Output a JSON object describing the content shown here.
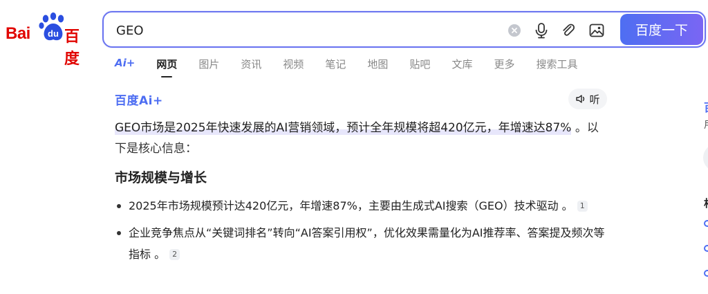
{
  "logo": {
    "latin": "Bai",
    "paw_text": "du",
    "chinese": "百度"
  },
  "search": {
    "value": "GEO",
    "button_label": "百度一下"
  },
  "tabs": [
    {
      "label": "Ai+"
    },
    {
      "label": "网页"
    },
    {
      "label": "图片"
    },
    {
      "label": "资讯"
    },
    {
      "label": "视频"
    },
    {
      "label": "笔记"
    },
    {
      "label": "地图"
    },
    {
      "label": "贴吧"
    },
    {
      "label": "文库"
    },
    {
      "label": "更多"
    },
    {
      "label": "搜索工具"
    }
  ],
  "ai_answer": {
    "brand": "百度Ai+",
    "listen_label": "听",
    "summary_highlight": "GEO市场是2025年快速发展的AI营销领域，预计全年规模将超420亿元，年增速达87%",
    "summary_rest": " 。以下是核心信息：",
    "section_title": "市场规模与增长",
    "bullets": [
      {
        "text": "2025年市场规模预计达420亿元，年增速87%，主要由生成式AI搜索（GEO）技术驱动 。",
        "ref": "1"
      },
      {
        "text": "企业竞争焦点从“关键词排名”转向“AI答案引用权”，优化效果需量化为AI推荐率、答案提及频次等指标 。",
        "ref": "2"
      }
    ]
  },
  "right_col": {
    "c1": "百",
    "c2": "用",
    "c4": "相"
  },
  "colors": {
    "brand_red": "#e10602",
    "accent_blue": "#4e6ef2",
    "search_border": "#6a74f0"
  }
}
